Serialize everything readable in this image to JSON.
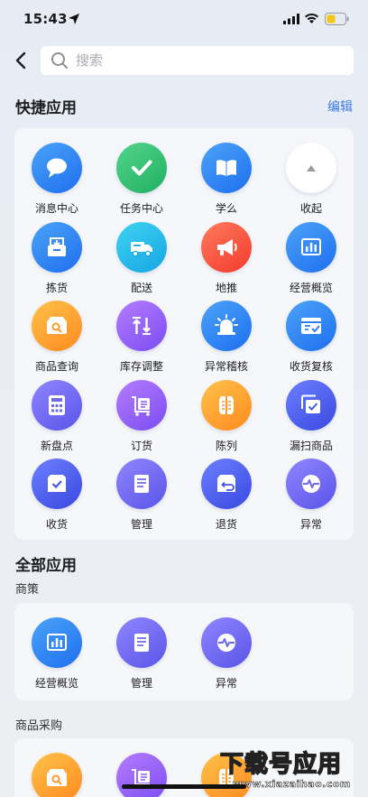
{
  "status_bar": {
    "time": "15:43"
  },
  "search": {
    "placeholder": "搜索"
  },
  "quick_apps": {
    "title": "快捷应用",
    "edit_label": "编辑",
    "rows": [
      [
        {
          "label": "消息中心",
          "icon": "chat-bubble-icon",
          "color": "blue"
        },
        {
          "label": "任务中心",
          "icon": "checkmark-icon",
          "color": "green"
        },
        {
          "label": "学么",
          "icon": "book-icon",
          "color": "blue"
        },
        {
          "label": "收起",
          "icon": "collapse-arrow-icon",
          "color": "white"
        }
      ],
      [
        {
          "label": "拣货",
          "icon": "box-icon",
          "color": "blue"
        },
        {
          "label": "配送",
          "icon": "truck-icon",
          "color": "cyan"
        },
        {
          "label": "地推",
          "icon": "megaphone-icon",
          "color": "red"
        },
        {
          "label": "经营概览",
          "icon": "bar-chart-icon",
          "color": "blue"
        }
      ],
      [
        {
          "label": "商品查询",
          "icon": "search-box-icon",
          "color": "orange"
        },
        {
          "label": "库存调整",
          "icon": "arrows-updown-icon",
          "color": "purple"
        },
        {
          "label": "异常稽核",
          "icon": "alarm-light-icon",
          "color": "blue"
        },
        {
          "label": "收货复核",
          "icon": "receipt-check-icon",
          "color": "blue"
        }
      ],
      [
        {
          "label": "新盘点",
          "icon": "calculator-icon",
          "color": "violet"
        },
        {
          "label": "订货",
          "icon": "cart-doc-icon",
          "color": "purple"
        },
        {
          "label": "陈列",
          "icon": "shelf-icon",
          "color": "orange"
        },
        {
          "label": "漏扫商品",
          "icon": "copy-check-icon",
          "color": "indigo"
        }
      ],
      [
        {
          "label": "收货",
          "icon": "inbox-check-icon",
          "color": "indigo"
        },
        {
          "label": "管理",
          "icon": "document-icon",
          "color": "violet"
        },
        {
          "label": "退货",
          "icon": "return-box-icon",
          "color": "indigo"
        },
        {
          "label": "异常",
          "icon": "pulse-icon",
          "color": "violet"
        }
      ]
    ]
  },
  "all_apps": {
    "title": "全部应用",
    "groups": [
      {
        "name": "商策",
        "apps": [
          {
            "label": "经营概览",
            "icon": "bar-chart-icon",
            "color": "blue"
          },
          {
            "label": "管理",
            "icon": "document-icon",
            "color": "violet"
          },
          {
            "label": "异常",
            "icon": "pulse-icon",
            "color": "violet"
          }
        ]
      },
      {
        "name": "商品采购",
        "apps": [
          {
            "label": "",
            "icon": "search-box-icon",
            "color": "orange"
          },
          {
            "label": "",
            "icon": "cart-doc-icon",
            "color": "purple"
          },
          {
            "label": "",
            "icon": "shelf-icon",
            "color": "orange"
          }
        ]
      }
    ]
  },
  "watermark": {
    "main": "下载号应用",
    "url": "www.xiazaihao.com"
  },
  "colors": {
    "accent_link": "#3a7be8",
    "blue": [
      "#4aa3f7",
      "#1f6ff0"
    ],
    "green": [
      "#53d48b",
      "#21b063"
    ],
    "cyan": [
      "#3fd3f0",
      "#16a5e6"
    ],
    "red": [
      "#ff7a5c",
      "#f23b2e"
    ],
    "orange": [
      "#ffc24a",
      "#ff8a1f"
    ],
    "purple": [
      "#b57cff",
      "#7b4df2"
    ],
    "violet": [
      "#8f86ff",
      "#5a54e8"
    ],
    "indigo": [
      "#6d80ff",
      "#3848e0"
    ]
  }
}
